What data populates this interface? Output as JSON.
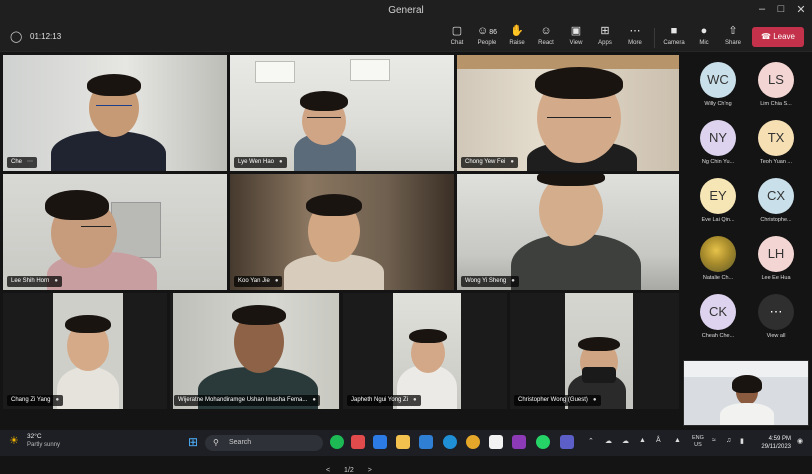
{
  "window": {
    "title": "General"
  },
  "meeting": {
    "timer": "01:12:13",
    "toolbar": [
      {
        "id": "chat",
        "label": "Chat",
        "icon": "chat-icon",
        "glyph": "▢"
      },
      {
        "id": "people",
        "label": "People",
        "icon": "people-icon",
        "glyph": "☺",
        "count": "86"
      },
      {
        "id": "raise",
        "label": "Raise",
        "icon": "raise-hand-icon",
        "glyph": "✋"
      },
      {
        "id": "react",
        "label": "React",
        "icon": "react-icon",
        "glyph": "☺"
      },
      {
        "id": "view",
        "label": "View",
        "icon": "view-icon",
        "glyph": "▣"
      },
      {
        "id": "apps",
        "label": "Apps",
        "icon": "apps-icon",
        "glyph": "⊞"
      },
      {
        "id": "more",
        "label": "More",
        "icon": "more-icon",
        "glyph": "⋯"
      },
      {
        "id": "camera",
        "label": "Camera",
        "icon": "camera-icon",
        "glyph": "■"
      },
      {
        "id": "mic",
        "label": "Mic",
        "icon": "mic-icon",
        "glyph": "●"
      },
      {
        "id": "share",
        "label": "Share",
        "icon": "share-icon",
        "glyph": "⇧"
      }
    ],
    "leave_label": "Leave",
    "participants": [
      {
        "name": "Che",
        "extra": "⋯"
      },
      {
        "name": "Lye Wen Hao"
      },
      {
        "name": "Chong Yew Fei"
      },
      {
        "name": "Lee Shih Horn"
      },
      {
        "name": "Koo Yan Jie"
      },
      {
        "name": "Wong Yi Sheng"
      },
      {
        "name": "Chang Zi Yang"
      },
      {
        "name": "Wijeratne Mohandiramge Ushan Imasha Fema..."
      },
      {
        "name": "Japheth Ngui Yong Zi"
      },
      {
        "name": "Christopher Wong (Guest)"
      }
    ],
    "pager": {
      "prev": "<",
      "text": "1/2",
      "next": ">"
    },
    "side_panel": [
      {
        "initials": "WC",
        "name": "Willy Ch'ng",
        "color": "#c9dfe9"
      },
      {
        "initials": "LS",
        "name": "Lim Chia S...",
        "color": "#f3d6d3"
      },
      {
        "initials": "NY",
        "name": "Ng Chin Yu...",
        "color": "#ddd3ee"
      },
      {
        "initials": "TX",
        "name": "Teoh Yuan ...",
        "color": "#f6e0b3"
      },
      {
        "initials": "EY",
        "name": "Eve Lai Qin...",
        "color": "#f6e5b5"
      },
      {
        "initials": "CX",
        "name": "Christophe...",
        "color": "#c9dfe9"
      },
      {
        "initials": "",
        "name": "Natalie Ch...",
        "color": "#7a7a2a",
        "photo": true
      },
      {
        "initials": "LH",
        "name": "Lee Ee Hua",
        "color": "#f3d6d3"
      },
      {
        "initials": "CK",
        "name": "Cheah Che...",
        "color": "#ddd3ee"
      },
      {
        "initials": "⋯",
        "name": "View all",
        "color": "#2f2f2f"
      }
    ]
  },
  "taskbar": {
    "weather_temp": "32°C",
    "weather_desc": "Partly sunny",
    "search_placeholder": "Search",
    "lang_top": "ENG",
    "lang_bottom": "US",
    "time": "4:59 PM",
    "date": "29/11/2023"
  }
}
